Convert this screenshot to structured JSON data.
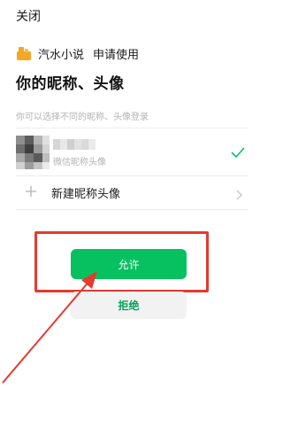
{
  "header": {
    "close_label": "关闭"
  },
  "app": {
    "name": "汽水小说",
    "request_text": "申请使用",
    "icon": "app-logo-icon"
  },
  "page": {
    "title": "你的昵称、头像",
    "hint": "你可以选择不同的昵称、头像登录"
  },
  "account": {
    "subtitle": "微信昵称头像",
    "selected_icon": "check-icon"
  },
  "new_profile": {
    "label": "新建昵称头像"
  },
  "buttons": {
    "allow_label": "允许",
    "reject_label": "拒绝"
  },
  "colors": {
    "primary_green": "#07c160",
    "annotation_red": "#e53a2f"
  }
}
